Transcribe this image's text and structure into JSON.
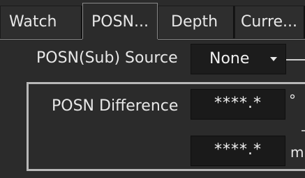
{
  "tabs": [
    {
      "label": "Watch",
      "active": false
    },
    {
      "label": "POSN...",
      "active": true
    },
    {
      "label": "Depth",
      "active": false
    },
    {
      "label": "Curre...",
      "active": false
    }
  ],
  "posn_source": {
    "label": "POSN(Sub) Source",
    "value": "None"
  },
  "posn_difference": {
    "label": "POSN Difference",
    "angle_value": "****.*",
    "angle_unit": "°",
    "distance_value": "****.*",
    "distance_unit": "m"
  }
}
